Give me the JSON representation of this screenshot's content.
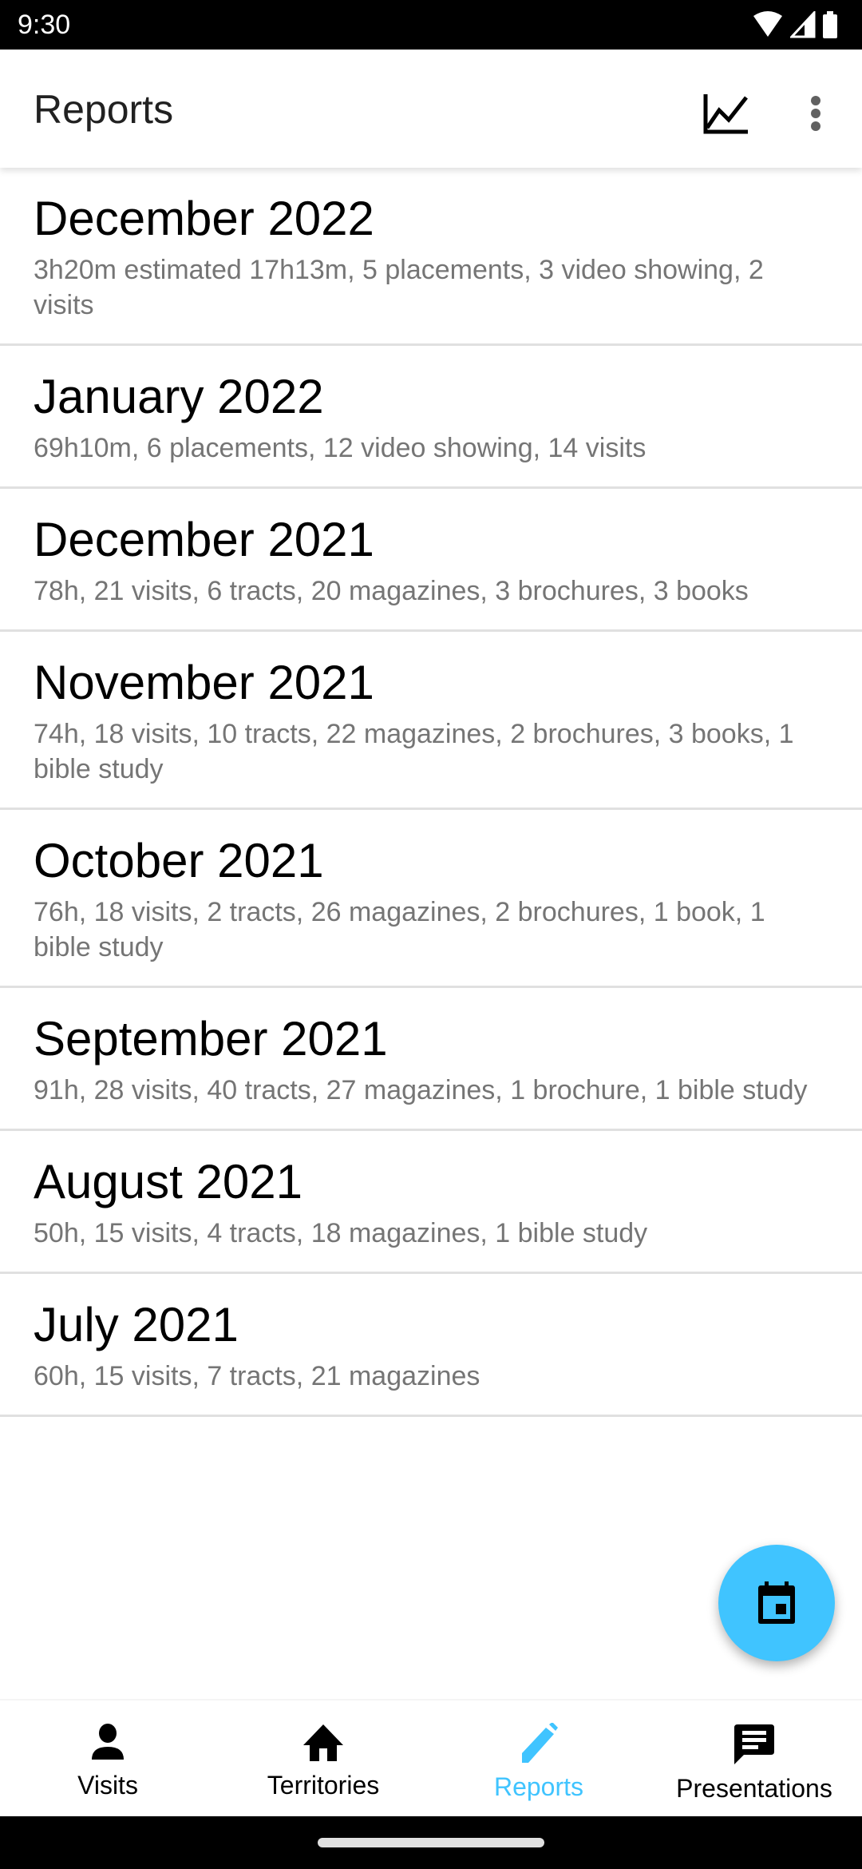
{
  "status_bar": {
    "time": "9:30"
  },
  "app_bar": {
    "title": "Reports",
    "chart_icon": "show-chart-icon",
    "more_icon": "more-vert-icon"
  },
  "reports": [
    {
      "title": "December 2022",
      "summary": "3h20m estimated 17h13m, 5 placements, 3 video showing, 2 visits"
    },
    {
      "title": "January 2022",
      "summary": "69h10m, 6 placements, 12 video showing, 14 visits"
    },
    {
      "title": "December 2021",
      "summary": "78h, 21 visits, 6 tracts, 20 magazines, 3 brochures, 3 books"
    },
    {
      "title": "November 2021",
      "summary": "74h, 18 visits, 10 tracts, 22 magazines, 2 brochures, 3 books, 1 bible study"
    },
    {
      "title": "October 2021",
      "summary": "76h, 18 visits, 2 tracts, 26 magazines, 2 brochures, 1 book, 1 bible study"
    },
    {
      "title": "September 2021",
      "summary": "91h, 28 visits, 40 tracts, 27 magazines, 1 brochure, 1 bible study"
    },
    {
      "title": "August 2021",
      "summary": "50h, 15 visits, 4 tracts, 18 magazines, 1 bible study"
    },
    {
      "title": "July 2021",
      "summary": "60h, 15 visits, 7 tracts, 21 magazines"
    }
  ],
  "fab": {
    "icon": "calendar-today-icon"
  },
  "bottom_nav": {
    "active": "Reports",
    "accent_color": "#40c4ff",
    "items": [
      {
        "label": "Visits",
        "icon": "person-icon"
      },
      {
        "label": "Territories",
        "icon": "home-icon"
      },
      {
        "label": "Reports",
        "icon": "pencil-icon"
      },
      {
        "label": "Presentations",
        "icon": "chat-icon"
      }
    ]
  }
}
